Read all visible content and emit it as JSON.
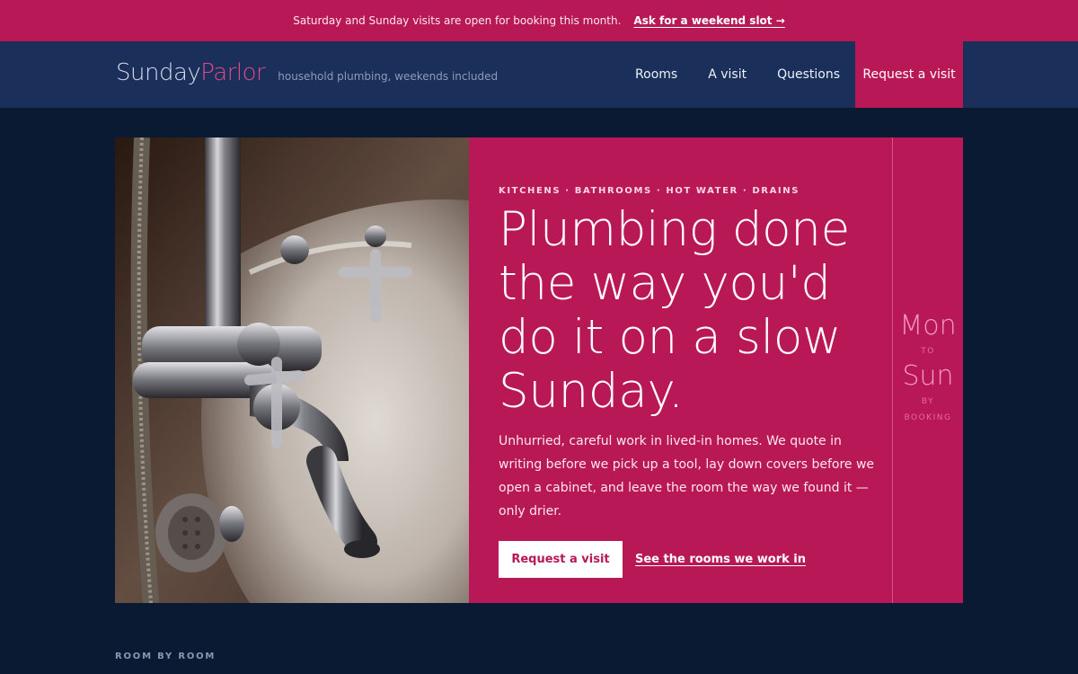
{
  "announcement": {
    "message": "Saturday and Sunday visits are open for booking this month.",
    "cta": "Ask for a weekend slot →"
  },
  "brand": {
    "name_part1": "Sunday",
    "name_part2": "Parlor",
    "tagline": "household plumbing, weekends included"
  },
  "nav": {
    "items": [
      "Rooms",
      "A visit",
      "Questions"
    ],
    "cta": "Request a visit"
  },
  "hero": {
    "eyebrow": "KITCHENS · BATHROOMS · HOT WATER · DRAINS",
    "headline": "Plumbing done the way you'd do it on a slow Sunday.",
    "body": "Unhurried, careful work in lived-in homes. We quote in writing before we pick up a tool, lay down covers before we open a cabinet, and leave the room the way we found it — only drier.",
    "primary_button": "Request a visit",
    "secondary_link": "See the rooms we work in"
  },
  "schedule": {
    "start_day": "Mon",
    "to": "TO",
    "end_day": "Sun",
    "by": "BY",
    "booking": "BOOKING"
  },
  "section": {
    "label": "ROOM BY ROOM"
  },
  "colors": {
    "accent": "#b91856",
    "navy_dark": "#0b1a33",
    "navy_header": "#1a2f5a"
  }
}
